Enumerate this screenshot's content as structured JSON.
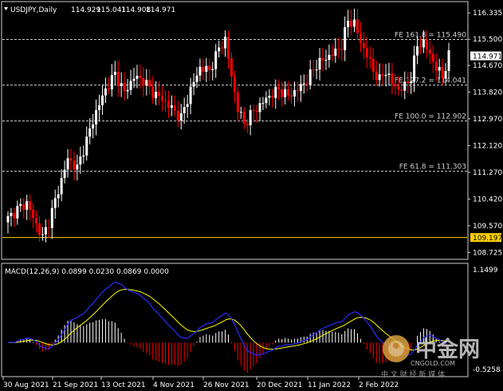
{
  "chart_data": {
    "type": "candlestick",
    "symbol": "USDJPY",
    "timeframe": "Daily",
    "ohlc_header": [
      "114.929",
      "115.041",
      "114.908",
      "114.971"
    ],
    "current_price": "114.971",
    "ylim": [
      108.58,
      116.62
    ],
    "price_ticks": [
      "116.335",
      "115.500",
      "114.670",
      "113.820",
      "112.970",
      "112.120",
      "111.270",
      "110.420",
      "109.570",
      "108.725"
    ],
    "x_ticks": [
      "30 Aug 2021",
      "21 Sep 2021",
      "13 Oct 2021",
      "4 Nov 2021",
      "26 Nov 2021",
      "20 Dec 2021",
      "11 Jan 2022",
      "2 Feb 2022"
    ],
    "lines": [
      {
        "label": "FE 161.8 = 115.490",
        "value": 115.49
      },
      {
        "label": "FE 127.2 = 114.041",
        "value": 114.041
      },
      {
        "label": "FE 100.0 = 112.902",
        "value": 112.902
      },
      {
        "label": "FE 61.8 = 111.303",
        "value": 111.303
      }
    ],
    "low_line": {
      "label": "109.197",
      "value": 109.197
    },
    "anchors": [
      [
        0,
        109.8
      ],
      [
        3,
        110.1
      ],
      [
        6,
        110.3
      ],
      [
        9,
        109.6
      ],
      [
        11,
        109.2
      ],
      [
        13,
        109.7
      ],
      [
        16,
        110.7
      ],
      [
        19,
        111.7
      ],
      [
        22,
        111.4
      ],
      [
        25,
        112.3
      ],
      [
        28,
        113.2
      ],
      [
        31,
        113.9
      ],
      [
        34,
        114.4
      ],
      [
        37,
        113.8
      ],
      [
        40,
        114.3
      ],
      [
        43,
        114.2
      ],
      [
        46,
        113.8
      ],
      [
        49,
        113.6
      ],
      [
        52,
        113.3
      ],
      [
        55,
        113.0
      ],
      [
        58,
        113.9
      ],
      [
        61,
        114.6
      ],
      [
        64,
        114.5
      ],
      [
        67,
        115.2
      ],
      [
        69,
        115.5
      ],
      [
        71,
        114.3
      ],
      [
        73,
        113.3
      ],
      [
        75,
        112.8
      ],
      [
        77,
        113.1
      ],
      [
        80,
        113.4
      ],
      [
        83,
        113.7
      ],
      [
        86,
        113.9
      ],
      [
        89,
        113.7
      ],
      [
        92,
        113.9
      ],
      [
        95,
        114.2
      ],
      [
        98,
        114.7
      ],
      [
        101,
        114.9
      ],
      [
        104,
        115.1
      ],
      [
        106,
        115.3
      ],
      [
        108,
        116.1
      ],
      [
        110,
        116.0
      ],
      [
        112,
        115.4
      ],
      [
        114,
        115.0
      ],
      [
        116,
        114.5
      ],
      [
        118,
        114.2
      ],
      [
        120,
        114.5
      ],
      [
        122,
        114.1
      ],
      [
        124,
        113.9
      ],
      [
        126,
        114.0
      ],
      [
        128,
        114.3
      ],
      [
        130,
        115.3
      ],
      [
        132,
        115.4
      ],
      [
        134,
        115.0
      ],
      [
        136,
        114.6
      ],
      [
        138,
        114.3
      ],
      [
        140,
        114.97
      ]
    ],
    "macd": {
      "label": "MACD(12,26,9)",
      "values": [
        "0.0899",
        "0.0230",
        "0.0869",
        "0.0000"
      ],
      "max_label": "1.1499",
      "min_label": "-0.5258"
    }
  },
  "watermark": {
    "brand_cn": "中金网",
    "site": "CNGOLD.COM",
    "tagline": "中 文 财 经 新 媒 体"
  },
  "colors": {
    "bull": "#ffffff",
    "bear": "#ff0000",
    "signal": "#ffff00",
    "macd_line": "#2a2aff",
    "low_line": "#ffd000"
  }
}
